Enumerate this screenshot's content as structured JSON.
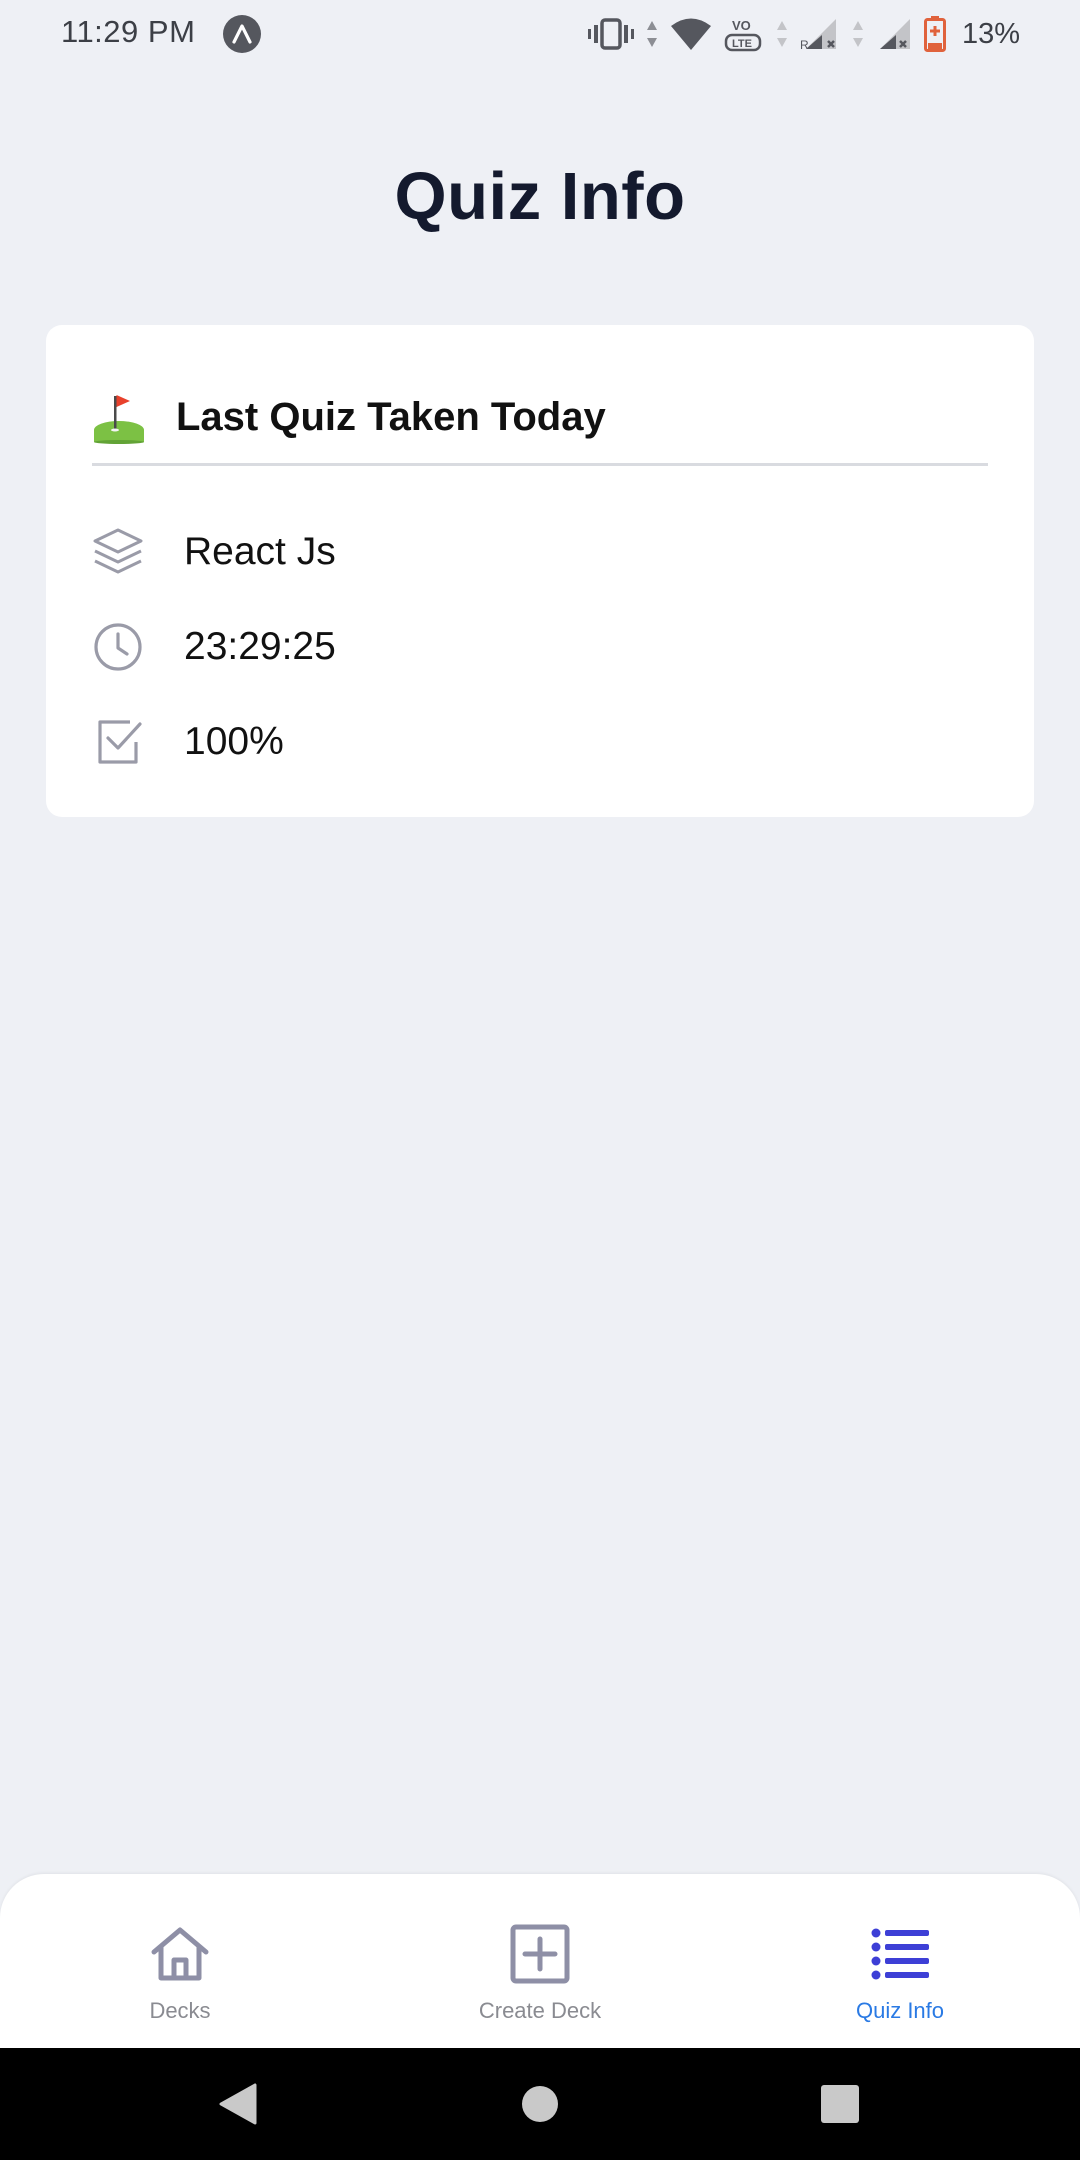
{
  "status_bar": {
    "time": "11:29 PM",
    "battery": "13%",
    "icons": [
      "vibrate-icon",
      "wifi-icon",
      "volte-icon",
      "signal-icon",
      "battery-icon"
    ]
  },
  "page": {
    "title": "Quiz Info"
  },
  "card": {
    "header_icon": "flag-in-hole-emoji",
    "header_title": "Last Quiz Taken Today",
    "rows": [
      {
        "icon": "layers-icon",
        "text": "React Js"
      },
      {
        "icon": "clock-icon",
        "text": "23:29:25"
      },
      {
        "icon": "checkbox-icon",
        "text": "100%"
      }
    ]
  },
  "tabs": [
    {
      "label": "Decks",
      "icon": "home-icon",
      "active": false
    },
    {
      "label": "Create Deck",
      "icon": "plus-square-icon",
      "active": false
    },
    {
      "label": "Quiz Info",
      "icon": "list-icon",
      "active": true
    }
  ],
  "colors": {
    "background": "#eef0f5",
    "card": "#ffffff",
    "title": "#141a2e",
    "tab_active_label": "#2a7ae4",
    "tab_active_icon": "#3d3fd6",
    "tab_inactive": "#8a8b91",
    "icon_gray": "#9a9ba8"
  }
}
